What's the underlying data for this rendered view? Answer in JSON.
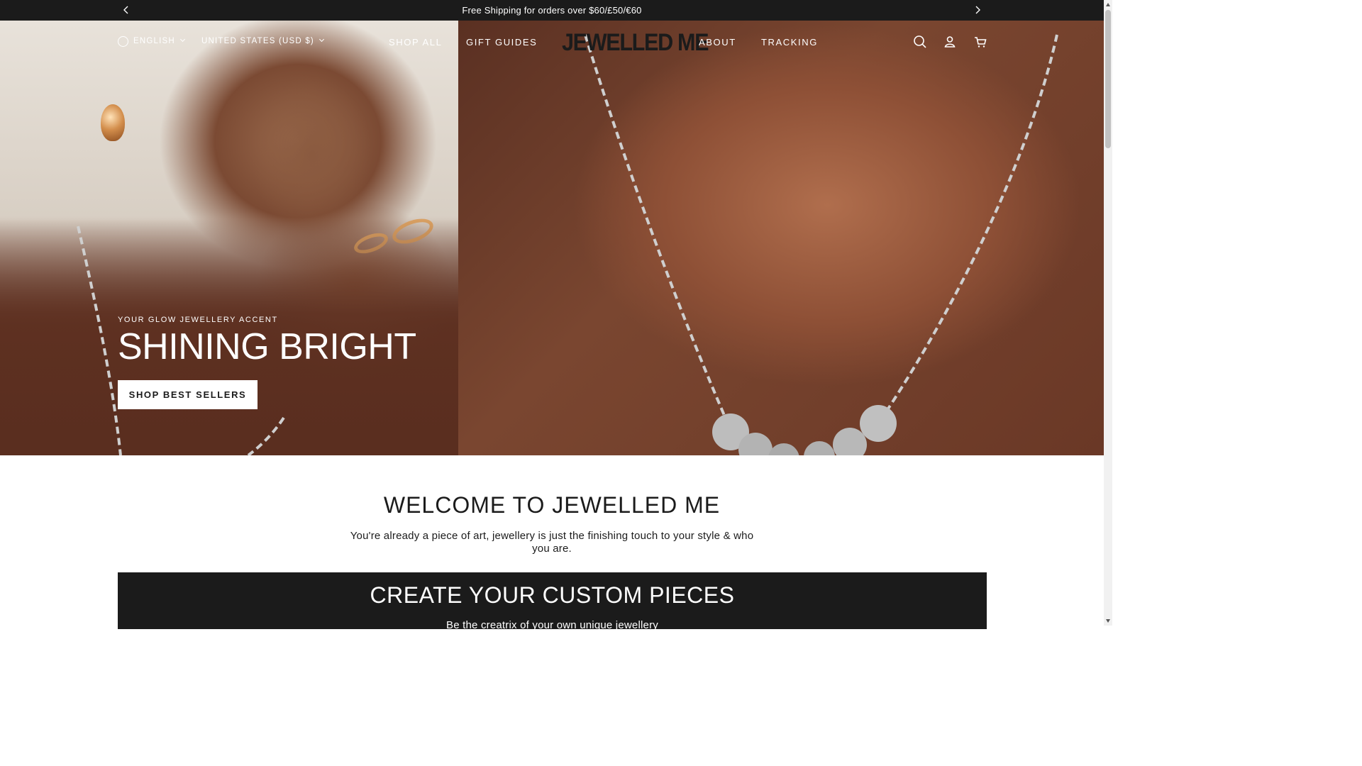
{
  "announcement": {
    "message": "Free Shipping for orders over $60/£50/€60",
    "prev_icon": "chevron-left-icon",
    "next_icon": "chevron-right-icon"
  },
  "header": {
    "language": "ENGLISH",
    "country": "UNITED STATES (USD $)",
    "nav": [
      "SHOP ALL",
      "GIFT GUIDES",
      "ABOUT",
      "TRACKING"
    ],
    "logo": "JEWELLED ME",
    "icons": [
      "search-icon",
      "account-icon",
      "cart-icon"
    ]
  },
  "hero": {
    "eyebrow": "YOUR GLOW JEWELLERY ACCENT",
    "headline": "SHINING BRIGHT",
    "cta": "SHOP BEST SELLERS"
  },
  "welcome": {
    "title": "WELCOME TO JEWELLED ME",
    "text": "You're already a piece of art, jewellery is just the finishing touch to your style & who you are."
  },
  "custom": {
    "title": "CREATE YOUR CUSTOM PIECES",
    "subtitle": "Be the creatrix of your own unique jewellery"
  },
  "colors": {
    "dark": "#1b1b1b",
    "white": "#ffffff"
  }
}
